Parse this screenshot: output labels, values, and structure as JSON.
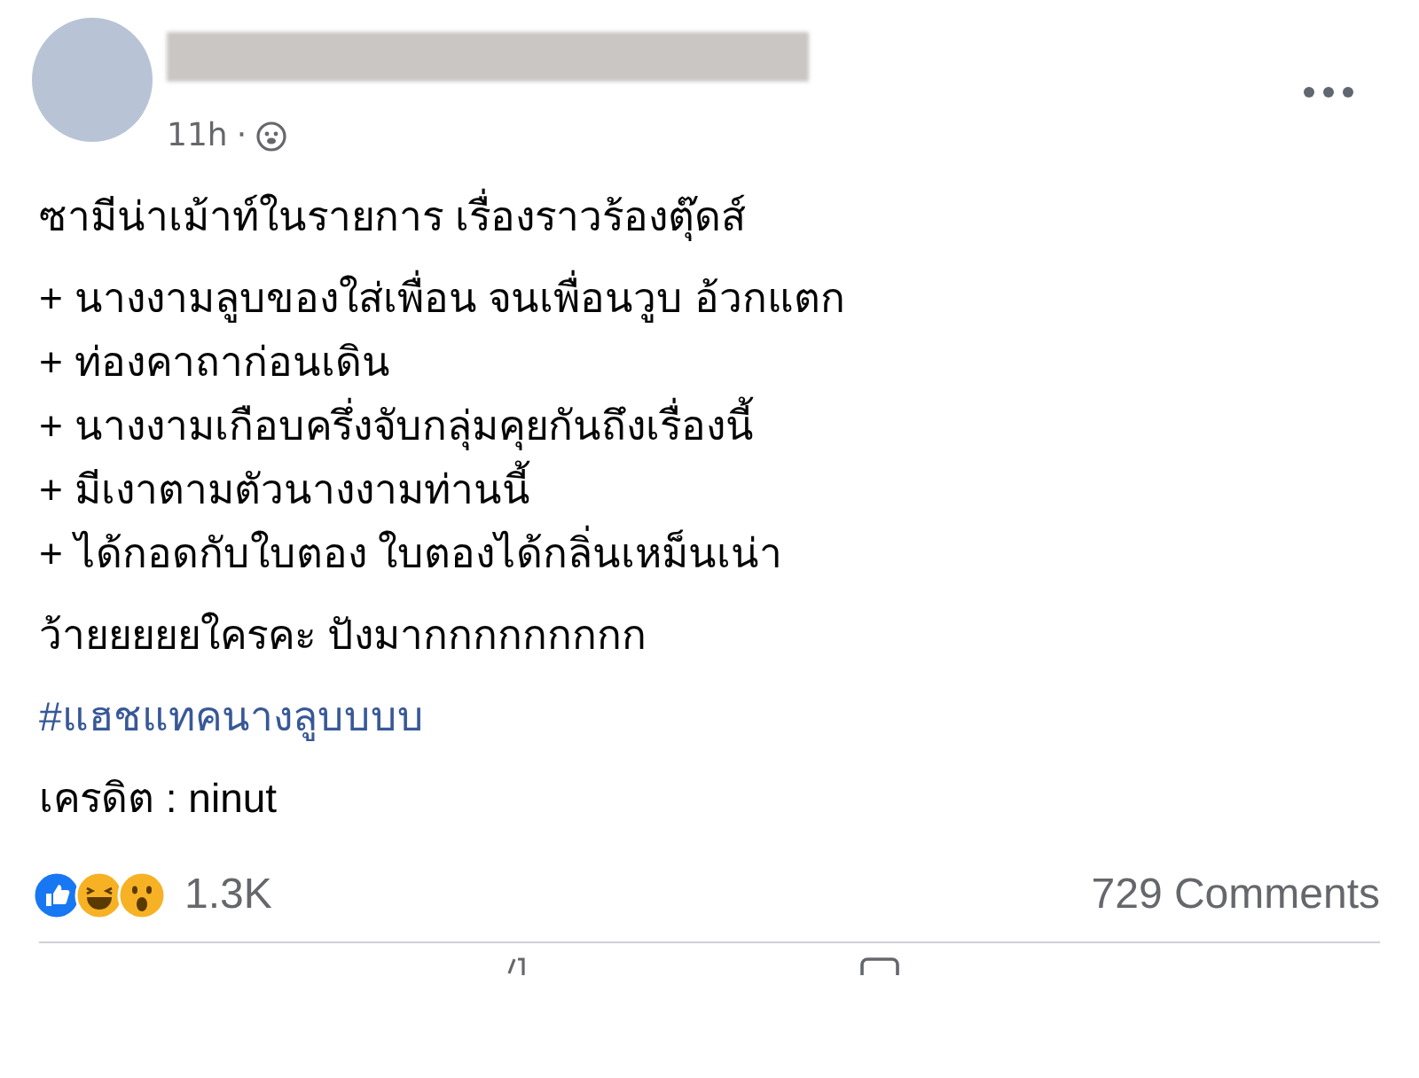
{
  "post": {
    "time": "11h",
    "separator": "·",
    "paragraphs": [
      {
        "kind": "text",
        "lines": [
          "ซามีน่าเม้าท์ในรายการ เรื่องราวร้องตุ๊ดส์"
        ]
      },
      {
        "kind": "text",
        "lines": [
          "+ นางงามลูบของใส่เพื่อน จนเพื่อนวูบ อ้วกแตก",
          "+ ท่องคาถาก่อนเดิน",
          "+ นางงามเกือบครึ่งจับกลุ่มคุยกันถึงเรื่องนี้",
          "+ มีเงาตามตัวนางงามท่านนี้",
          "+ ได้กอดกับใบตอง ใบตองได้กลิ่นเหม็นเน่า"
        ]
      },
      {
        "kind": "text",
        "lines": [
          "ว้ายยยยยใครคะ ปังมากกกกกกกกก"
        ]
      },
      {
        "kind": "hashtag",
        "lines": [
          "#แฮชแทคนางลูบบบบ"
        ]
      },
      {
        "kind": "text",
        "lines": [
          "เครดิต : ninut"
        ]
      }
    ],
    "reaction_count": "1.3K",
    "comments": "729 Comments"
  }
}
